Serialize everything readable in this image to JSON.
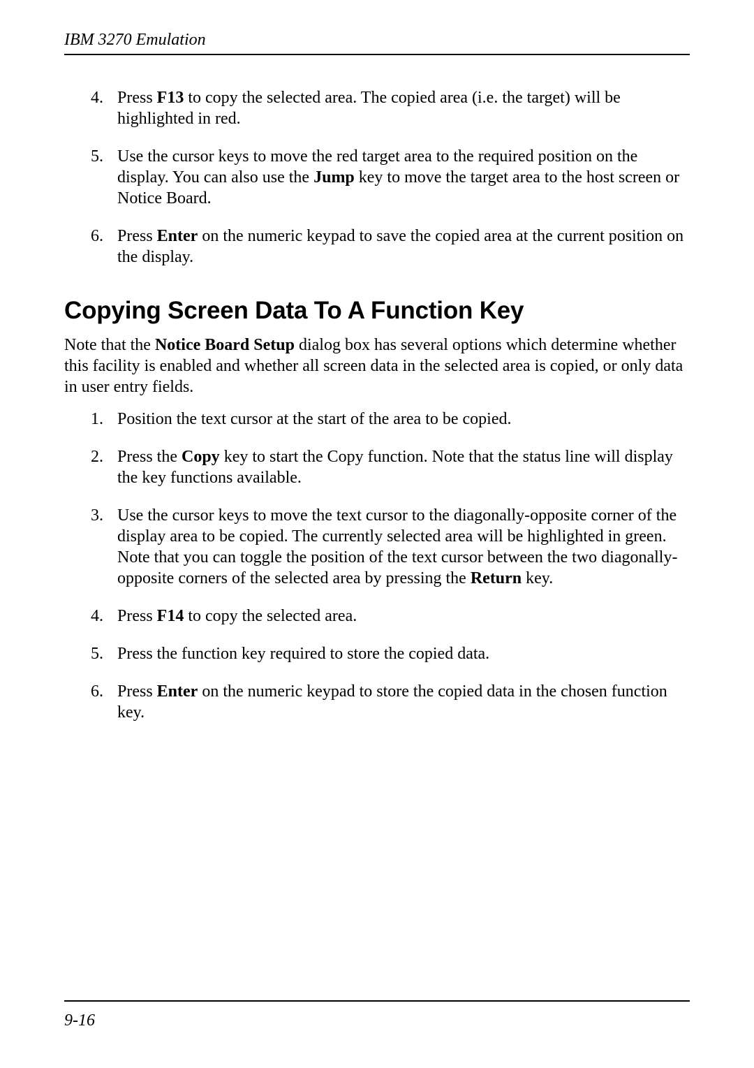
{
  "header": {
    "running_head": "IBM 3270 Emulation"
  },
  "top_list": {
    "start": 4,
    "items": [
      {
        "segments": [
          {
            "t": "Press ",
            "b": false
          },
          {
            "t": "F13",
            "b": true
          },
          {
            "t": " to copy the selected area. The copied area (i.e. the target) will be highlighted in red.",
            "b": false
          }
        ]
      },
      {
        "segments": [
          {
            "t": "Use the cursor keys to move the red target area to the required position on the display. You can also use the ",
            "b": false
          },
          {
            "t": "Jump",
            "b": true
          },
          {
            "t": " key to move the target area to the host screen or Notice Board.",
            "b": false
          }
        ]
      },
      {
        "segments": [
          {
            "t": "Press ",
            "b": false
          },
          {
            "t": "Enter",
            "b": true
          },
          {
            "t": " on the numeric keypad to save the copied area at the current position on the display.",
            "b": false
          }
        ]
      }
    ]
  },
  "section": {
    "title": "Copying Screen Data To A Function Key",
    "intro_segments": [
      {
        "t": "Note that the ",
        "b": false
      },
      {
        "t": "Notice Board Setup",
        "b": true
      },
      {
        "t": " dialog box has several options which determine whether this facility is enabled and whether all screen data in the selected area is copied, or only data in user entry fields.",
        "b": false
      }
    ],
    "list": {
      "start": 1,
      "items": [
        {
          "segments": [
            {
              "t": "Position the text cursor at the start of the area to be copied.",
              "b": false
            }
          ]
        },
        {
          "segments": [
            {
              "t": "Press the ",
              "b": false
            },
            {
              "t": "Copy",
              "b": true
            },
            {
              "t": " key to start the Copy function. Note that the status line will display the key functions available.",
              "b": false
            }
          ]
        },
        {
          "segments": [
            {
              "t": "Use the cursor keys to move the text cursor to the diagonally-opposite corner of the display area to be copied. The currently selected area will be highlighted in green. Note that you can toggle the position of the text cursor between the two diagonally-opposite corners of the selected area by pressing the ",
              "b": false
            },
            {
              "t": "Return",
              "b": true
            },
            {
              "t": " key.",
              "b": false
            }
          ]
        },
        {
          "segments": [
            {
              "t": "Press ",
              "b": false
            },
            {
              "t": "F14",
              "b": true
            },
            {
              "t": " to copy the selected area.",
              "b": false
            }
          ]
        },
        {
          "segments": [
            {
              "t": "Press the function key required to store the copied data.",
              "b": false
            }
          ]
        },
        {
          "segments": [
            {
              "t": "Press ",
              "b": false
            },
            {
              "t": "Enter",
              "b": true
            },
            {
              "t": " on the numeric keypad to store the copied data in the chosen function key.",
              "b": false
            }
          ]
        }
      ]
    }
  },
  "footer": {
    "page_number": "9-16"
  }
}
